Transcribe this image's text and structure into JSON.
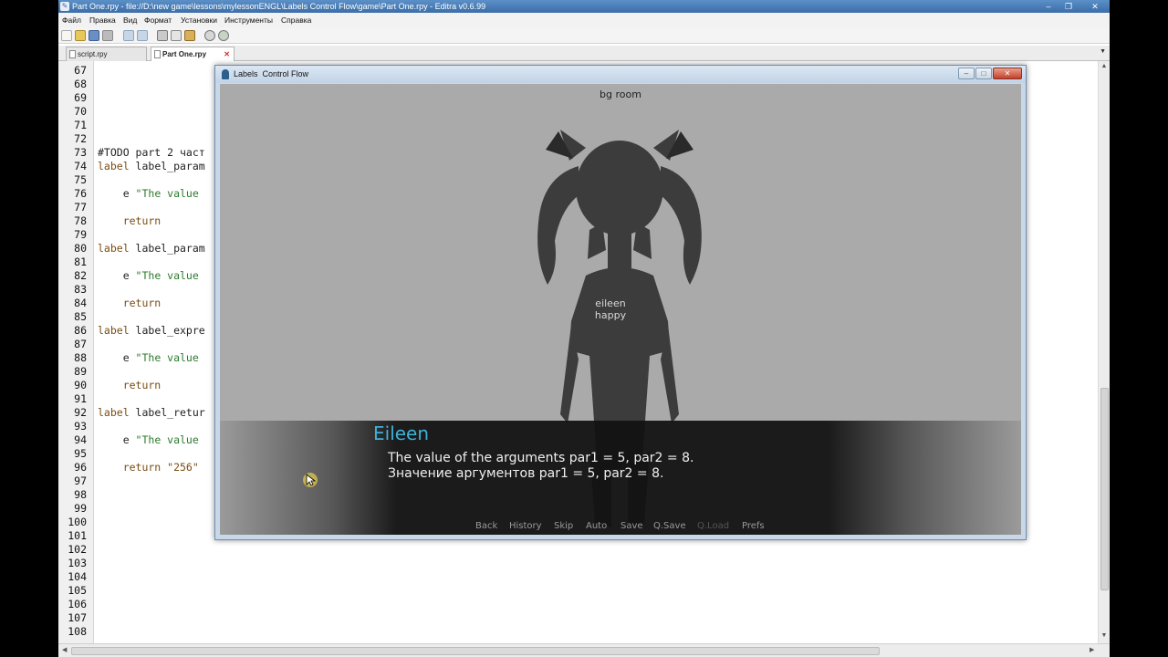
{
  "editor": {
    "title": "Part One.rpy - file://D:\\new game\\lessons\\mylessonENGL\\Labels  Control Flow\\game\\Part One.rpy - Editra v0.6.99",
    "menu": [
      "Файл",
      "Правка",
      "Вид",
      "Формат",
      "Установки",
      "Инструменты",
      "Справка"
    ],
    "tabs": [
      {
        "label": "script.rpy",
        "active": false
      },
      {
        "label": "Part One.rpy",
        "active": true
      }
    ],
    "line_numbers": [
      "67",
      "68",
      "69",
      "70",
      "71",
      "72",
      "73",
      "74",
      "75",
      "76",
      "77",
      "78",
      "79",
      "80",
      "81",
      "82",
      "83",
      "84",
      "85",
      "86",
      "87",
      "88",
      "89",
      "90",
      "91",
      "92",
      "93",
      "94",
      "95",
      "96",
      "97",
      "98",
      "99",
      "100",
      "101",
      "102",
      "103",
      "104",
      "105",
      "106",
      "107",
      "108"
    ],
    "code": {
      "l73": "#TODO part 2 част",
      "l74a": "label",
      "l74b": " label_param",
      "l76a": "    e ",
      "l76b": "\"The value",
      "l78": "    return",
      "l80a": "label",
      "l80b": " label_param",
      "l82a": "    e ",
      "l82b": "\"The value",
      "l84": "    return",
      "l86a": "label",
      "l86b": " label_expre",
      "l88a": "    e ",
      "l88b": "\"The value",
      "l90": "    return",
      "l92a": "label",
      "l92b": " label_retur",
      "l94a": "    e ",
      "l94b": "\"The value",
      "l96": "    return \"256\""
    }
  },
  "game": {
    "window_title": "Labels  Control Flow",
    "bg_label": "bg room",
    "sprite_label": [
      "eileen",
      "happy"
    ],
    "speaker": "Eileen",
    "dialogue": [
      "The value of the arguments par1 = 5, par2 = 8.",
      "Значение аргументов par1 = 5, par2 = 8."
    ],
    "colors": {
      "speaker": "#3fb0d8",
      "background": "#aaaaaa"
    },
    "quick_menu": [
      {
        "label": "Back",
        "enabled": true
      },
      {
        "label": "History",
        "enabled": true
      },
      {
        "label": "Skip",
        "enabled": true
      },
      {
        "label": "Auto",
        "enabled": true
      },
      {
        "label": "Save",
        "enabled": true
      },
      {
        "label": "Q.Save",
        "enabled": true
      },
      {
        "label": "Q.Load",
        "enabled": false
      },
      {
        "label": "Prefs",
        "enabled": true
      }
    ]
  }
}
